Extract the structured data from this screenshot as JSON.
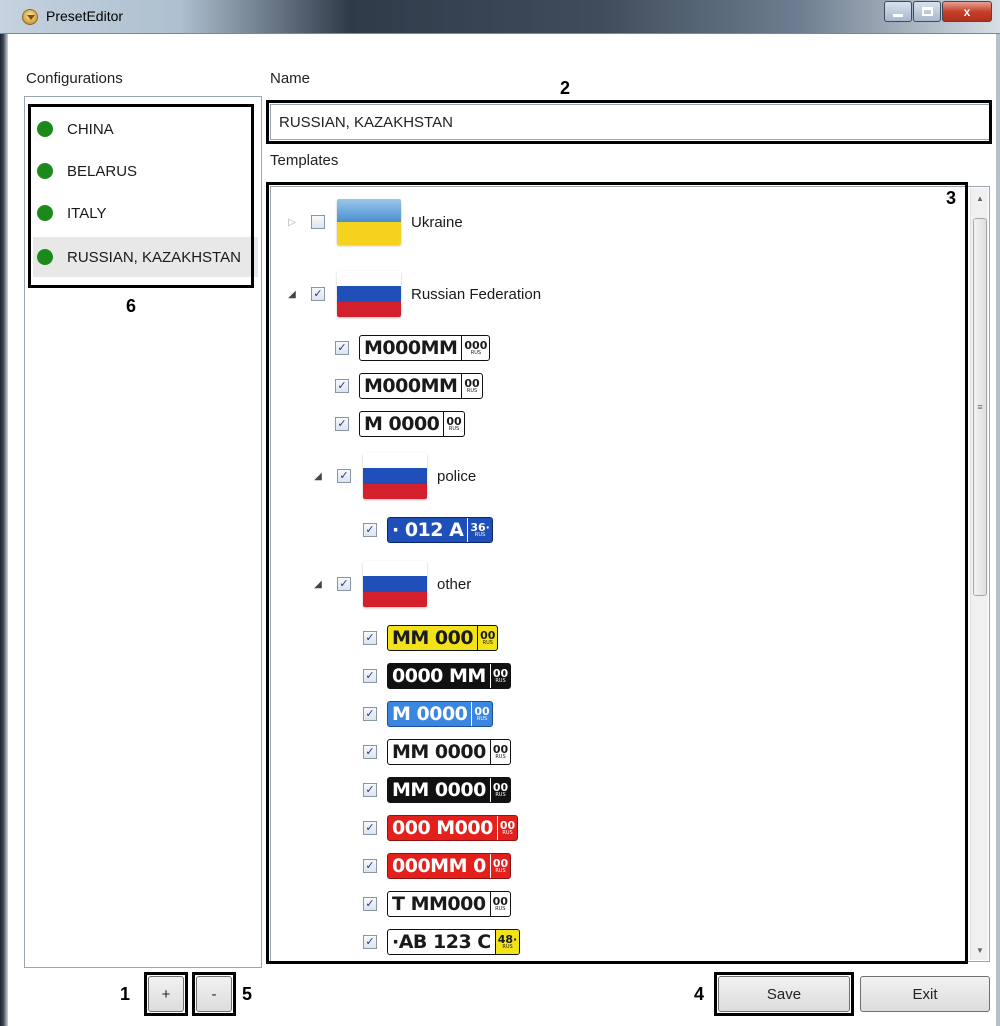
{
  "window": {
    "title": "PresetEditor",
    "close_glyph": "x"
  },
  "left": {
    "label": "Configurations",
    "items": [
      {
        "label": "CHINA",
        "status_color": "#1b8a1b"
      },
      {
        "label": "BELARUS",
        "status_color": "#1b8a1b"
      },
      {
        "label": "ITALY",
        "status_color": "#1b8a1b"
      },
      {
        "label": "RUSSIAN, KAZAKHSTAN",
        "status_color": "#1b8a1b",
        "selected": true
      }
    ],
    "add_label": "+",
    "remove_label": "-"
  },
  "name": {
    "label": "Name",
    "value": "RUSSIAN, KAZAKHSTAN"
  },
  "templates": {
    "label": "Templates",
    "tree": {
      "ukraine": {
        "label": "Ukraine",
        "checked": false,
        "expanded": false
      },
      "russia": {
        "label": "Russian Federation",
        "checked": true,
        "expanded": true
      },
      "police": {
        "label": "police",
        "checked": true,
        "expanded": true
      },
      "other": {
        "label": "other",
        "checked": true,
        "expanded": true
      }
    },
    "russia_plates": [
      {
        "main": "M000MM",
        "region": "000",
        "rus": "RUS"
      },
      {
        "main": "M000MM",
        "region": "00",
        "rus": "RUS"
      },
      {
        "main": "M 0000",
        "region": "00",
        "rus": "RUS"
      }
    ],
    "police_plates": [
      {
        "main": "· 012  A",
        "region": "36·",
        "rus": "RUS"
      }
    ],
    "other_plates": [
      {
        "main": "MM 000",
        "region": "00",
        "rus": "RUS"
      },
      {
        "main": "0000 MM",
        "region": "00",
        "rus": "RUS"
      },
      {
        "main": "M 0000",
        "region": "00",
        "rus": "RUS"
      },
      {
        "main": "MM 0000",
        "region": "00",
        "rus": "RUS"
      },
      {
        "main": "MM 0000",
        "region": "00",
        "rus": "RUS"
      },
      {
        "main": "000 M000",
        "region": "00",
        "rus": "RUS"
      },
      {
        "main": "000MM 0",
        "region": "00",
        "rus": "RUS"
      },
      {
        "main": "T MM000",
        "region": "00",
        "rus": "RUS"
      },
      {
        "main": "·AB 123 C",
        "region": "48·",
        "rus": "RUS"
      }
    ],
    "checkmark": "✓",
    "expanded_glyph": "◢",
    "collapsed_glyph": "▷"
  },
  "buttons": {
    "save": "Save",
    "exit": "Exit"
  },
  "annotations": {
    "n1": "1",
    "n2": "2",
    "n3": "3",
    "n4": "4",
    "n5": "5",
    "n6": "6"
  },
  "scrollbar": {
    "up": "▲",
    "down": "▼",
    "grip": "≡"
  },
  "colors": {
    "ukraine": [
      "#4a8fd0",
      "#f4d21e"
    ],
    "russia": [
      "#ffffff",
      "#1f4fb8",
      "#d3202c"
    ],
    "police_plate_bg": "#1f4fb8",
    "plate_yellow": "#f2e21a",
    "plate_black": "#111111",
    "plate_lightblue": "#3a86e0",
    "plate_red": "#e3201b",
    "plate_white": "#ffffff"
  }
}
